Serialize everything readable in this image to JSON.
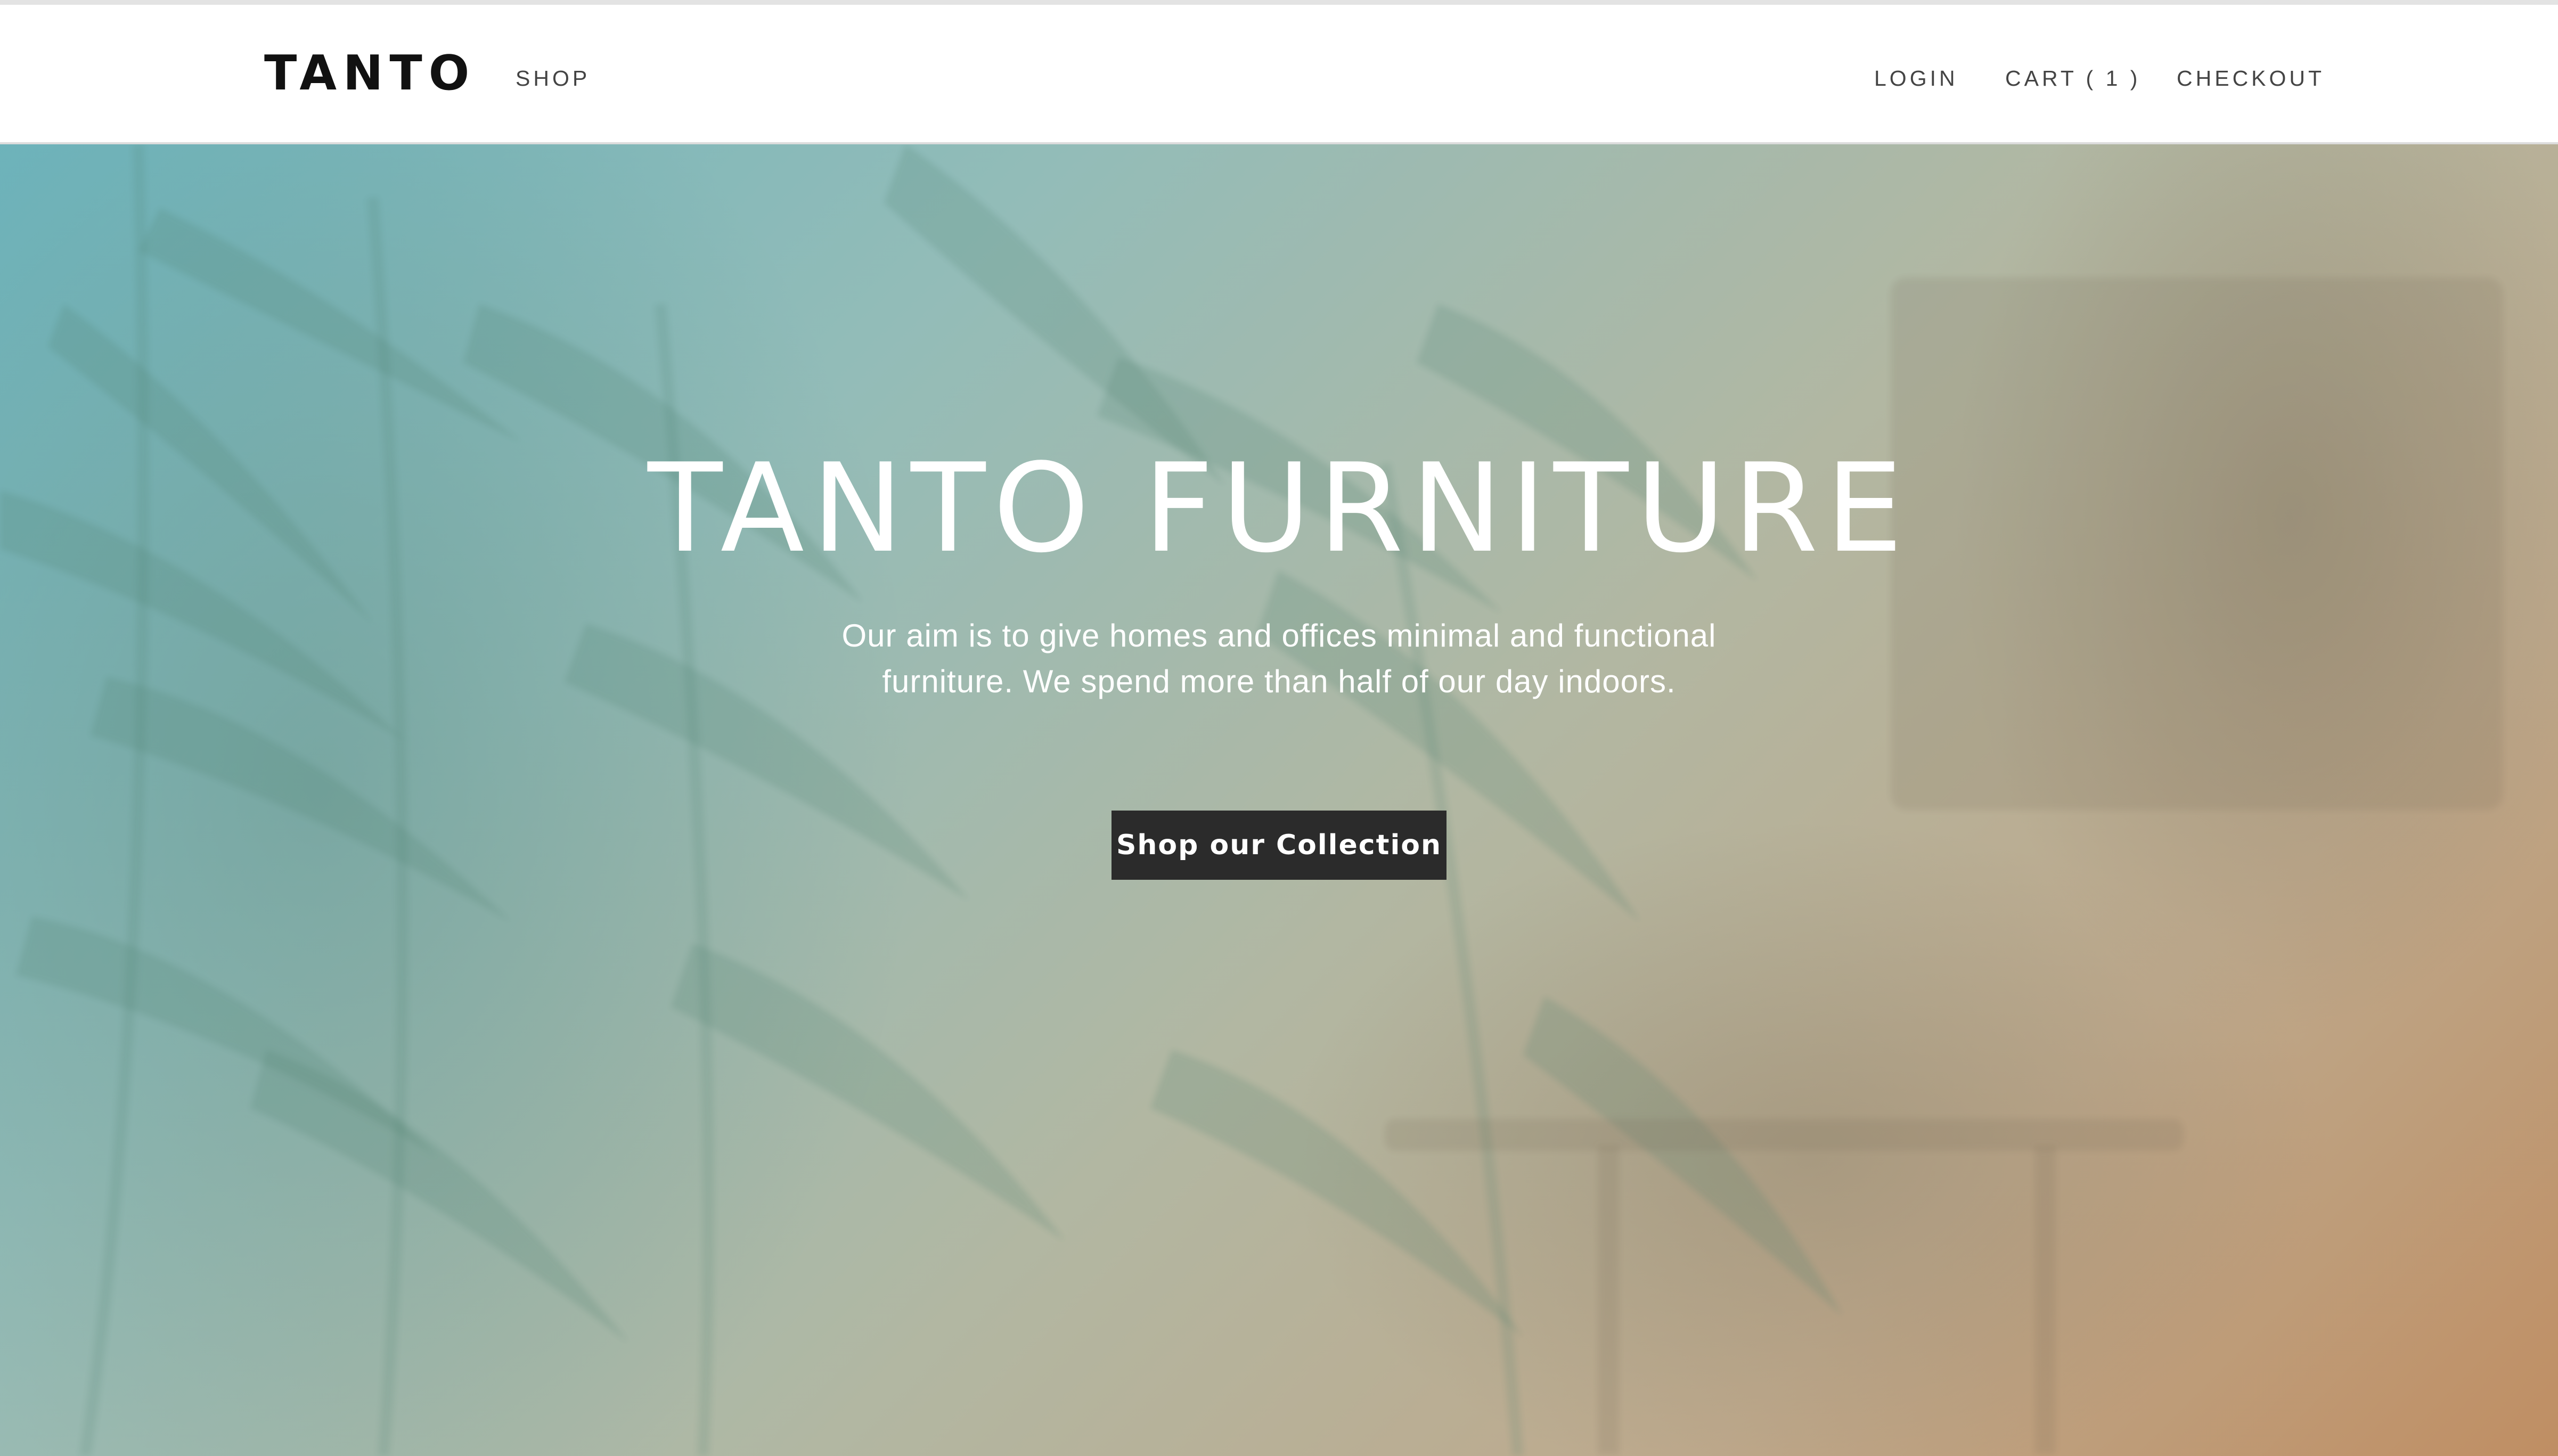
{
  "header": {
    "logo": "TANTO",
    "nav_left": [
      {
        "label": "SHOP"
      }
    ],
    "nav_right": [
      {
        "label": "LOGIN"
      },
      {
        "label": "CART ( 1 )"
      },
      {
        "label": "CHECKOUT"
      }
    ]
  },
  "hero": {
    "title": "TANTO FURNITURE",
    "subtitle_lines": [
      "Our aim is to give homes and offices minimal and functional",
      "furniture. We spend more than half of our day indoors."
    ],
    "button_label": "Shop our Collection"
  },
  "colors": {
    "header_bg": "#ffffff",
    "button_bg": "#2b2b2b",
    "hero_teal": "#6eb4bc",
    "hero_sand": "#bea98c",
    "hero_copper": "#bf8e63"
  }
}
